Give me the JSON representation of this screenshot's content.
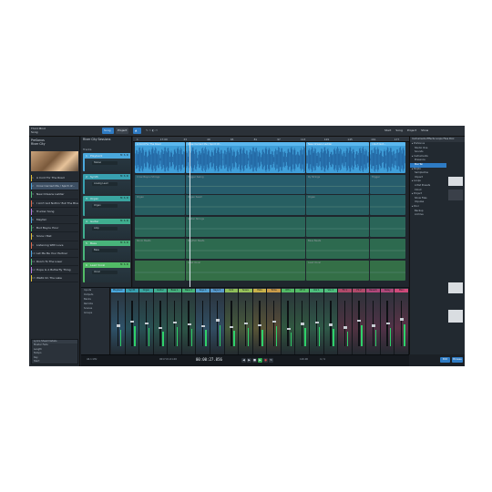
{
  "topbar": {
    "song_title": "Third Mind",
    "song_sub": "Song",
    "tab_song": "Song",
    "tab_project": "Project",
    "tab_show": "Show",
    "right_items": [
      "Start",
      "Song",
      "Project",
      "Show"
    ]
  },
  "artist": {
    "name": "PreSonus",
    "album": "River City"
  },
  "setlist": [
    {
      "num": "1",
      "title": "A Cord For The Road",
      "color": "#e6c23a"
    },
    {
      "num": "2",
      "title": "Crow Carried Me / Spirit of...",
      "color": "#4ea7e0",
      "selected": true
    },
    {
      "num": "3",
      "title": "New Orleans Ladder",
      "color": "#53c07a"
    },
    {
      "num": "4",
      "title": "I Ain't Got Nothin' But The Blues",
      "color": "#e06b4e"
    },
    {
      "num": "5",
      "title": "Trucker Song",
      "color": "#b67be0"
    },
    {
      "num": "6",
      "title": "Mayfair",
      "color": "#4ea7e0"
    },
    {
      "num": "7",
      "title": "Bud Bayou Hour",
      "color": "#53c07a"
    },
    {
      "num": "8",
      "title": "Since I Met",
      "color": "#e6c23a"
    },
    {
      "num": "9",
      "title": "Listening With Love",
      "color": "#e06b4e"
    },
    {
      "num": "10",
      "title": "Let Me Be Your Partner",
      "color": "#4ea7e0"
    },
    {
      "num": "11",
      "title": "Room To The Loser",
      "color": "#53c07a"
    },
    {
      "num": "12",
      "title": "Hope Is A Butterfly Thing",
      "color": "#b67be0"
    },
    {
      "num": "13",
      "title": "Waltz On The Lake",
      "color": "#e6c23a"
    }
  ],
  "leftbottom": {
    "header": "Lyrics Sheet Details",
    "rows": [
      "Master Fade",
      "Length",
      "Tempo",
      "Key",
      "Start"
    ]
  },
  "trackpanel": {
    "title": "River City Sessions",
    "subtitle": "Tracks"
  },
  "tracks": [
    {
      "num": "1",
      "name": "Playback",
      "ctrl": "Stereo",
      "color": "#4aa8dd"
    },
    {
      "num": "2",
      "name": "Synth",
      "ctrl": "Analog Lead",
      "color": "#38a0b0"
    },
    {
      "num": "3",
      "name": "Organ",
      "ctrl": "Organ",
      "color": "#3aa5a0"
    },
    {
      "num": "4",
      "name": "Guitar",
      "ctrl": "Amp",
      "color": "#3fae8f"
    },
    {
      "num": "5",
      "name": "Bass",
      "ctrl": "Bass",
      "color": "#48b47a"
    },
    {
      "num": "6",
      "name": "Lead Vocal",
      "ctrl": "Vocal",
      "color": "#52bb66"
    }
  ],
  "ruler_ticks": [
    "1",
    "17:00",
    "33",
    "49",
    "65",
    "81",
    "97",
    "113",
    "129",
    "145",
    "161",
    "177",
    "193",
    "209"
  ],
  "clips": {
    "lane1": [
      {
        "name": "A Cord For The Road",
        "w": 56
      },
      {
        "name": "Crow Carried Me / Spirit Of...",
        "w": 132
      },
      {
        "name": "New Orleans Ladder",
        "w": 70
      },
      {
        "name": "I Ain't Got...",
        "w": 40
      }
    ],
    "lane2": [
      {
        "name": "Crow Bayou Strings",
        "w": 56
      },
      {
        "name": "Trigger Swing",
        "w": 132
      },
      {
        "name": "Ry Strings",
        "w": 70
      },
      {
        "name": "Trigger",
        "w": 40
      }
    ],
    "lane3": [
      {
        "name": "Organ",
        "w": 56
      },
      {
        "name": "Organ Swell",
        "w": 132
      },
      {
        "name": "Organ",
        "w": 70
      },
      {
        "name": "",
        "w": 40
      }
    ],
    "lane4": [
      {
        "name": "",
        "w": 56
      },
      {
        "name": "Guitar Strings",
        "w": 132
      },
      {
        "name": "",
        "w": 70
      },
      {
        "name": "",
        "w": 40
      }
    ],
    "lane5": [
      {
        "name": "Ronin Beats",
        "w": 56
      },
      {
        "name": "Rhythm Beats",
        "w": 132
      },
      {
        "name": "Bass Beats",
        "w": 70
      },
      {
        "name": "",
        "w": 40
      }
    ],
    "lane6": [
      {
        "name": "",
        "w": 56
      },
      {
        "name": "Lead Vocal",
        "w": 132
      },
      {
        "name": "Lead Vocal",
        "w": 70
      },
      {
        "name": "",
        "w": 40
      }
    ]
  },
  "browser": {
    "tabs": "Instruments  Effects  Loops  Files  Pool",
    "items": [
      "PreSonus",
      "Studio One",
      "Sounds",
      "Instruments",
      "Presence",
      "Mai Tai",
      "Mojito",
      "SampleOne",
      "Impact",
      "Loops",
      "Artist Presets",
      "Cloud",
      "Project",
      "Show Files",
      "Impulse",
      "Pool",
      "Backup",
      "Archive"
    ],
    "highlighted": "Mai Tai"
  },
  "console": {
    "side": [
      "Inputs",
      "Outputs",
      "Banks",
      "Remote",
      "Scenes",
      "Groups"
    ],
    "strips": [
      {
        "name": "Playback",
        "color": "#4aa8dd",
        "fader": 0.45
      },
      {
        "name": "Synth",
        "color": "#38a0b0",
        "fader": 0.55
      },
      {
        "name": "Organ",
        "color": "#3aa5a0",
        "fader": 0.5
      },
      {
        "name": "Guitar",
        "color": "#3fae8f",
        "fader": 0.4
      },
      {
        "name": "Bass 1",
        "color": "#46b07e",
        "fader": 0.52
      },
      {
        "name": "Bass 2",
        "color": "#48b47a",
        "fader": 0.48
      },
      {
        "name": "Keys 1",
        "color": "#52a0d0",
        "fader": 0.44
      },
      {
        "name": "Keys 2",
        "color": "#5799cc",
        "fader": 0.58
      },
      {
        "name": "Kick",
        "color": "#8fbf5a",
        "fader": 0.42
      },
      {
        "name": "Snare",
        "color": "#96c15a",
        "fader": 0.5
      },
      {
        "name": "Hats",
        "color": "#c9b24a",
        "fader": 0.46
      },
      {
        "name": "Toms",
        "color": "#c99b4a",
        "fader": 0.54
      },
      {
        "name": "OH L",
        "color": "#52bb66",
        "fader": 0.38
      },
      {
        "name": "OH R",
        "color": "#52bb66",
        "fader": 0.49
      },
      {
        "name": "Vox 1",
        "color": "#4ebf7e",
        "fader": 0.53
      },
      {
        "name": "Vox 2",
        "color": "#4ebf7e",
        "fader": 0.47
      },
      {
        "name": "FX 1",
        "color": "#b04a6a",
        "fader": 0.41
      },
      {
        "name": "FX 2",
        "color": "#b04a6a",
        "fader": 0.57
      },
      {
        "name": "Reverb",
        "color": "#b0487a",
        "fader": 0.45
      },
      {
        "name": "Delay",
        "color": "#b0487a",
        "fader": 0.5
      },
      {
        "name": "Main",
        "color": "#d04a7a",
        "fader": 0.6
      }
    ]
  },
  "transport": {
    "time": "00:00:27.856",
    "left_info": "44.1 kHz",
    "bars": "0017.01.01.00",
    "tempo": "120.00",
    "sig": "4 / 4"
  },
  "right_buttons": {
    "edit": "Edit",
    "browse": "Browse"
  }
}
